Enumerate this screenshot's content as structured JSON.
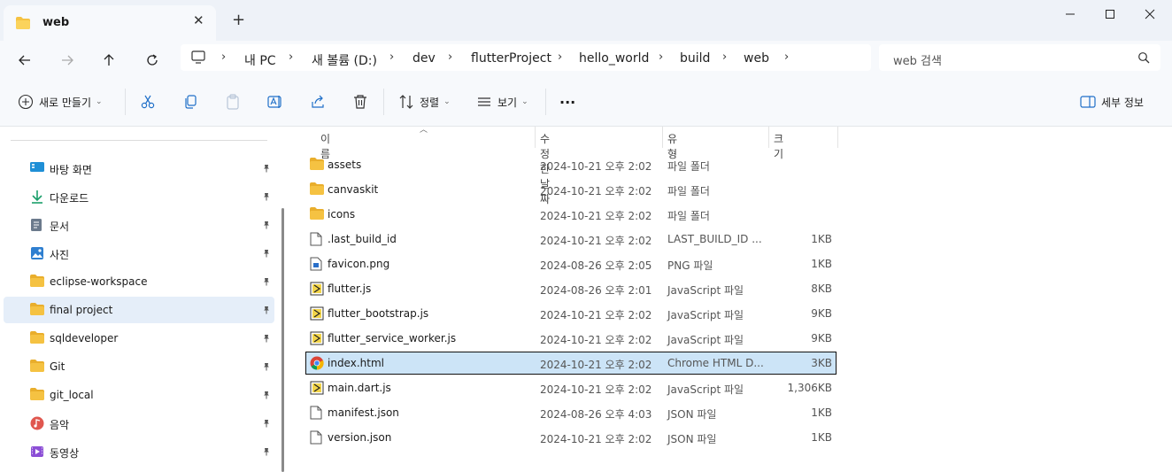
{
  "window": {
    "tab_title": "web",
    "close_tab": "✕",
    "new_tab": "+"
  },
  "address": {
    "crumbs": [
      "내 PC",
      "새 볼륨 (D:)",
      "dev",
      "flutterProject",
      "hello_world",
      "build",
      "web"
    ]
  },
  "search": {
    "placeholder": "web 검색"
  },
  "toolbar": {
    "new_label": "새로 만들기",
    "sort_label": "정렬",
    "view_label": "보기",
    "more_label": "···",
    "details_label": "세부 정보"
  },
  "sidebar": {
    "items": [
      {
        "label": "바탕 화면",
        "icon": "desktop-icon",
        "color": "#1f8fd6"
      },
      {
        "label": "다운로드",
        "icon": "download-icon",
        "color": "#1a9e6a"
      },
      {
        "label": "문서",
        "icon": "document-icon",
        "color": "#6b7a8c"
      },
      {
        "label": "사진",
        "icon": "pictures-icon",
        "color": "#2f7fd0"
      },
      {
        "label": "eclipse-workspace",
        "icon": "folder-icon",
        "color": "#f5c242"
      },
      {
        "label": "final project",
        "icon": "folder-icon",
        "color": "#f5c242",
        "selected": true
      },
      {
        "label": "sqldeveloper",
        "icon": "folder-icon",
        "color": "#f5c242"
      },
      {
        "label": "Git",
        "icon": "folder-icon",
        "color": "#f5c242"
      },
      {
        "label": "git_local",
        "icon": "folder-icon",
        "color": "#f5c242"
      },
      {
        "label": "음악",
        "icon": "music-icon",
        "color": "#e0574f"
      },
      {
        "label": "동영상",
        "icon": "video-icon",
        "color": "#8c4fd6"
      }
    ]
  },
  "columns": {
    "name": "이름",
    "date": "수정한 날짜",
    "type": "유형",
    "size": "크기"
  },
  "files": [
    {
      "name": "assets",
      "date": "2024-10-21 오후 2:02",
      "type": "파일 폴더",
      "size": "",
      "icon": "folder-icon"
    },
    {
      "name": "canvaskit",
      "date": "2024-10-21 오후 2:02",
      "type": "파일 폴더",
      "size": "",
      "icon": "folder-icon"
    },
    {
      "name": "icons",
      "date": "2024-10-21 오후 2:02",
      "type": "파일 폴더",
      "size": "",
      "icon": "folder-icon"
    },
    {
      "name": ".last_build_id",
      "date": "2024-10-21 오후 2:02",
      "type": "LAST_BUILD_ID ...",
      "size": "1KB",
      "icon": "file-icon"
    },
    {
      "name": "favicon.png",
      "date": "2024-08-26 오후 2:05",
      "type": "PNG 파일",
      "size": "1KB",
      "icon": "image-file-icon"
    },
    {
      "name": "flutter.js",
      "date": "2024-08-26 오후 2:01",
      "type": "JavaScript 파일",
      "size": "8KB",
      "icon": "script-file-icon"
    },
    {
      "name": "flutter_bootstrap.js",
      "date": "2024-10-21 오후 2:02",
      "type": "JavaScript 파일",
      "size": "9KB",
      "icon": "script-file-icon"
    },
    {
      "name": "flutter_service_worker.js",
      "date": "2024-10-21 오후 2:02",
      "type": "JavaScript 파일",
      "size": "9KB",
      "icon": "script-file-icon"
    },
    {
      "name": "index.html",
      "date": "2024-10-21 오후 2:02",
      "type": "Chrome HTML D...",
      "size": "3KB",
      "icon": "chrome-icon",
      "selected": true
    },
    {
      "name": "main.dart.js",
      "date": "2024-10-21 오후 2:02",
      "type": "JavaScript 파일",
      "size": "1,306KB",
      "icon": "script-file-icon"
    },
    {
      "name": "manifest.json",
      "date": "2024-08-26 오후 4:03",
      "type": "JSON 파일",
      "size": "1KB",
      "icon": "file-icon"
    },
    {
      "name": "version.json",
      "date": "2024-10-21 오후 2:02",
      "type": "JSON 파일",
      "size": "1KB",
      "icon": "file-icon"
    }
  ]
}
